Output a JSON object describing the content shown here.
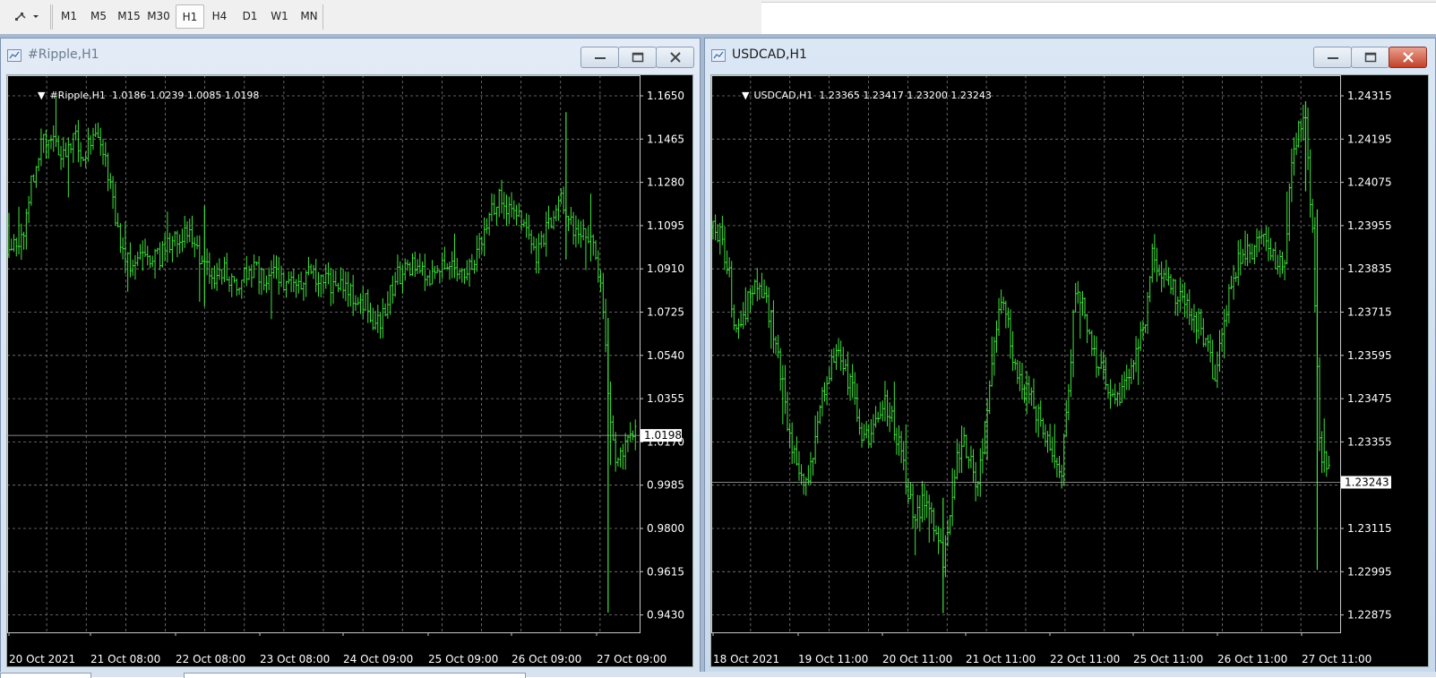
{
  "toolbar": {
    "draw_tool_icon": "line-studies-icon",
    "timeframes": [
      "M1",
      "M5",
      "M15",
      "M30",
      "H1",
      "H4",
      "D1",
      "W1",
      "MN"
    ],
    "active_timeframe": "H1"
  },
  "windows": [
    {
      "title": "#Ripple,H1",
      "active": false,
      "info": "#Ripple,H1  1.0186 1.0239 1.0085 1.0198",
      "price_axis": [
        "1.1650",
        "1.1465",
        "1.1280",
        "1.1095",
        "1.0910",
        "1.0725",
        "1.0540",
        "1.0355",
        "1.0170",
        "0.9985",
        "0.9800",
        "0.9615",
        "0.9430"
      ],
      "current_price": "1.0198",
      "time_axis": [
        "20 Oct 2021",
        "21 Oct 08:00",
        "22 Oct 08:00",
        "23 Oct 08:00",
        "24 Oct 09:00",
        "25 Oct 09:00",
        "26 Oct 09:00",
        "27 Oct 09:00"
      ]
    },
    {
      "title": "USDCAD,H1",
      "active": true,
      "info": "USDCAD,H1  1.23365 1.23417 1.23200 1.23243",
      "price_axis": [
        "1.24315",
        "1.24195",
        "1.24075",
        "1.23955",
        "1.23835",
        "1.23715",
        "1.23595",
        "1.23475",
        "1.23355",
        "1.23235",
        "1.23115",
        "1.22995",
        "1.22875"
      ],
      "current_price": "1.23243",
      "time_axis": [
        "18 Oct 2021",
        "19 Oct 11:00",
        "20 Oct 11:00",
        "21 Oct 11:00",
        "22 Oct 11:00",
        "25 Oct 11:00",
        "26 Oct 11:00",
        "27 Oct 11:00"
      ]
    }
  ],
  "chart_data": [
    {
      "type": "bar",
      "title": "#Ripple,H1",
      "series": [
        {
          "name": "#Ripple,H1",
          "style": "OHLC bars",
          "close_path": [
            [
              0,
              1.097
            ],
            [
              3,
              1.1
            ],
            [
              6,
              1.105
            ],
            [
              9,
              1.128
            ],
            [
              12,
              1.14
            ],
            [
              15,
              1.148
            ],
            [
              18,
              1.143
            ],
            [
              21,
              1.139
            ],
            [
              24,
              1.142
            ],
            [
              27,
              1.147
            ],
            [
              30,
              1.14
            ],
            [
              33,
              1.145
            ],
            [
              36,
              1.149
            ],
            [
              39,
              1.14
            ],
            [
              42,
              1.118
            ],
            [
              45,
              1.103
            ],
            [
              48,
              1.095
            ],
            [
              51,
              1.092
            ],
            [
              54,
              1.095
            ],
            [
              57,
              1.097
            ],
            [
              60,
              1.096
            ],
            [
              63,
              1.099
            ],
            [
              66,
              1.102
            ],
            [
              69,
              1.104
            ],
            [
              72,
              1.106
            ],
            [
              75,
              1.099
            ],
            [
              78,
              1.093
            ],
            [
              81,
              1.089
            ],
            [
              84,
              1.087
            ],
            [
              87,
              1.089
            ],
            [
              90,
              1.087
            ],
            [
              93,
              1.086
            ],
            [
              96,
              1.089
            ],
            [
              99,
              1.09
            ],
            [
              102,
              1.087
            ],
            [
              105,
              1.089
            ],
            [
              108,
              1.088
            ],
            [
              111,
              1.085
            ],
            [
              114,
              1.083
            ],
            [
              117,
              1.086
            ],
            [
              120,
              1.089
            ],
            [
              123,
              1.09
            ],
            [
              126,
              1.087
            ],
            [
              129,
              1.086
            ],
            [
              132,
              1.084
            ],
            [
              135,
              1.081
            ],
            [
              138,
              1.082
            ],
            [
              141,
              1.078
            ],
            [
              144,
              1.076
            ],
            [
              147,
              1.07
            ],
            [
              150,
              1.068
            ],
            [
              153,
              1.078
            ],
            [
              156,
              1.087
            ],
            [
              159,
              1.09
            ],
            [
              162,
              1.091
            ],
            [
              165,
              1.092
            ],
            [
              168,
              1.089
            ],
            [
              171,
              1.087
            ],
            [
              174,
              1.092
            ],
            [
              177,
              1.095
            ],
            [
              180,
              1.094
            ],
            [
              183,
              1.09
            ],
            [
              186,
              1.092
            ],
            [
              189,
              1.098
            ],
            [
              192,
              1.109
            ],
            [
              195,
              1.118
            ],
            [
              198,
              1.121
            ],
            [
              201,
              1.119
            ],
            [
              204,
              1.115
            ],
            [
              207,
              1.109
            ],
            [
              210,
              1.103
            ],
            [
              213,
              1.098
            ],
            [
              216,
              1.106
            ],
            [
              219,
              1.113
            ],
            [
              222,
              1.121
            ],
            [
              225,
              1.116
            ],
            [
              228,
              1.108
            ],
            [
              231,
              1.106
            ],
            [
              234,
              1.104
            ],
            [
              237,
              1.099
            ],
            [
              240,
              1.075
            ],
            [
              242,
              1.035
            ],
            [
              245,
              1.005
            ],
            [
              248,
              1.013
            ],
            [
              251,
              1.018
            ],
            [
              254,
              1.02
            ]
          ]
        }
      ],
      "ylim": [
        0.943,
        1.165
      ]
    },
    {
      "type": "bar",
      "title": "USDCAD,H1",
      "series": [
        {
          "name": "USDCAD,H1",
          "style": "OHLC bars",
          "close_path": [
            [
              0,
              1.2395
            ],
            [
              3,
              1.2393
            ],
            [
              6,
              1.2386
            ],
            [
              9,
              1.237
            ],
            [
              12,
              1.2366
            ],
            [
              15,
              1.2374
            ],
            [
              18,
              1.2378
            ],
            [
              21,
              1.2376
            ],
            [
              24,
              1.2372
            ],
            [
              27,
              1.2364
            ],
            [
              30,
              1.235
            ],
            [
              33,
              1.2338
            ],
            [
              36,
              1.2328
            ],
            [
              39,
              1.2322
            ],
            [
              42,
              1.233
            ],
            [
              45,
              1.2341
            ],
            [
              48,
              1.2351
            ],
            [
              51,
              1.2356
            ],
            [
              54,
              1.236
            ],
            [
              57,
              1.2356
            ],
            [
              60,
              1.2349
            ],
            [
              63,
              1.234
            ],
            [
              66,
              1.2336
            ],
            [
              69,
              1.2342
            ],
            [
              72,
              1.2346
            ],
            [
              75,
              1.2345
            ],
            [
              78,
              1.234
            ],
            [
              81,
              1.2332
            ],
            [
              84,
              1.2321
            ],
            [
              87,
              1.2313
            ],
            [
              90,
              1.2318
            ],
            [
              93,
              1.2317
            ],
            [
              96,
              1.231
            ],
            [
              99,
              1.2302
            ],
            [
              102,
              1.2316
            ],
            [
              105,
              1.2331
            ],
            [
              108,
              1.2335
            ],
            [
              111,
              1.2329
            ],
            [
              114,
              1.2323
            ],
            [
              117,
              1.2338
            ],
            [
              120,
              1.2356
            ],
            [
              123,
              1.2375
            ],
            [
              126,
              1.237
            ],
            [
              129,
              1.236
            ],
            [
              132,
              1.2354
            ],
            [
              135,
              1.2349
            ],
            [
              138,
              1.2345
            ],
            [
              141,
              1.2341
            ],
            [
              144,
              1.2335
            ],
            [
              147,
              1.233
            ],
            [
              150,
              1.2328
            ],
            [
              153,
              1.235
            ],
            [
              156,
              1.2378
            ],
            [
              159,
              1.2373
            ],
            [
              162,
              1.2364
            ],
            [
              165,
              1.2359
            ],
            [
              168,
              1.2354
            ],
            [
              171,
              1.235
            ],
            [
              174,
              1.2346
            ],
            [
              177,
              1.2352
            ],
            [
              180,
              1.2358
            ],
            [
              183,
              1.2361
            ],
            [
              186,
              1.2369
            ],
            [
              189,
              1.2389
            ],
            [
              192,
              1.2384
            ],
            [
              195,
              1.238
            ],
            [
              198,
              1.2378
            ],
            [
              201,
              1.2374
            ],
            [
              204,
              1.2372
            ],
            [
              207,
              1.237
            ],
            [
              210,
              1.2368
            ],
            [
              213,
              1.236
            ],
            [
              216,
              1.2352
            ],
            [
              219,
              1.2364
            ],
            [
              222,
              1.2379
            ],
            [
              225,
              1.2384
            ],
            [
              228,
              1.2389
            ],
            [
              231,
              1.2388
            ],
            [
              234,
              1.239
            ],
            [
              237,
              1.239
            ],
            [
              240,
              1.2388
            ],
            [
              243,
              1.2386
            ],
            [
              246,
              1.2386
            ],
            [
              249,
              1.2416
            ],
            [
              252,
              1.2422
            ],
            [
              255,
              1.2423
            ],
            [
              258,
              1.2392
            ],
            [
              261,
              1.2334
            ],
            [
              264,
              1.233
            ],
            [
              266,
              1.2324
            ]
          ]
        }
      ],
      "ylim": [
        1.22875,
        1.24315
      ]
    }
  ]
}
